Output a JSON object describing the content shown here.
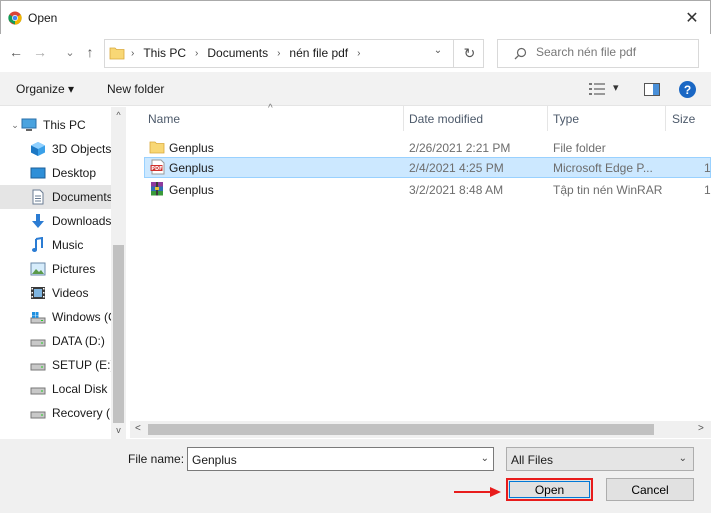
{
  "window": {
    "title": "Open",
    "close_glyph": "✕",
    "app_icon": "chrome-icon"
  },
  "nav": {
    "back_glyph": "←",
    "forward_glyph": "→",
    "recent_glyph": "⌄",
    "up_glyph": "↑",
    "breadcrumb": [
      "This PC",
      "Documents",
      "nén file pdf"
    ],
    "crumb_sep": "›",
    "dropdown_glyph": "⌄",
    "refresh_glyph": "↻",
    "search_placeholder": "Search nén file pdf"
  },
  "toolbar": {
    "organize_label": "Organize ▾",
    "new_folder_label": "New folder",
    "view_dropdown_glyph": "▾",
    "help_glyph": "?"
  },
  "sidebar": {
    "items": [
      {
        "label": "This PC",
        "icon": "computer-icon",
        "state": ""
      },
      {
        "label": "3D Objects",
        "icon": "cube-icon",
        "state": ""
      },
      {
        "label": "Desktop",
        "icon": "desktop-icon",
        "state": ""
      },
      {
        "label": "Documents",
        "icon": "document-icon",
        "state": "hover"
      },
      {
        "label": "Downloads",
        "icon": "download-icon",
        "state": ""
      },
      {
        "label": "Music",
        "icon": "music-icon",
        "state": ""
      },
      {
        "label": "Pictures",
        "icon": "pictures-icon",
        "state": ""
      },
      {
        "label": "Videos",
        "icon": "video-icon",
        "state": ""
      },
      {
        "label": "Windows (C",
        "icon": "drive-icon",
        "state": ""
      },
      {
        "label": "DATA (D:)",
        "icon": "drive-icon",
        "state": ""
      },
      {
        "label": "SETUP (E:)",
        "icon": "drive-icon",
        "state": ""
      },
      {
        "label": "Local Disk (",
        "icon": "drive-icon",
        "state": ""
      },
      {
        "label": "Recovery (H",
        "icon": "drive-icon",
        "state": ""
      }
    ],
    "chevron_glyph": "›",
    "scroll_up_glyph": "^",
    "scroll_down_glyph": "v"
  },
  "columns": {
    "name": "Name",
    "date": "Date modified",
    "type": "Type",
    "size": "Size",
    "sort_glyph": "^"
  },
  "files": [
    {
      "name": "Genplus",
      "date": "2/26/2021 2:21 PM",
      "type": "File folder",
      "size": "",
      "icon": "folder-icon",
      "selected": false
    },
    {
      "name": "Genplus",
      "date": "2/4/2021 4:25 PM",
      "type": "Microsoft Edge P...",
      "size": "1",
      "icon": "pdf-icon",
      "selected": true
    },
    {
      "name": "Genplus",
      "date": "3/2/2021 8:48 AM",
      "type": "Tập tin nén WinRAR",
      "size": "1",
      "icon": "winrar-icon",
      "selected": false
    }
  ],
  "hscroll": {
    "left_glyph": "<",
    "right_glyph": ">"
  },
  "footer": {
    "file_name_label": "File name:",
    "file_name_value": "Genplus",
    "file_name_dd": "⌄",
    "filter_value": "All Files",
    "filter_dd": "⌄",
    "open_label": "Open",
    "cancel_label": "Cancel"
  },
  "colors": {
    "selection": "#cce8ff",
    "annotation_red": "#e81c1c",
    "accent_blue": "#0078d7"
  }
}
